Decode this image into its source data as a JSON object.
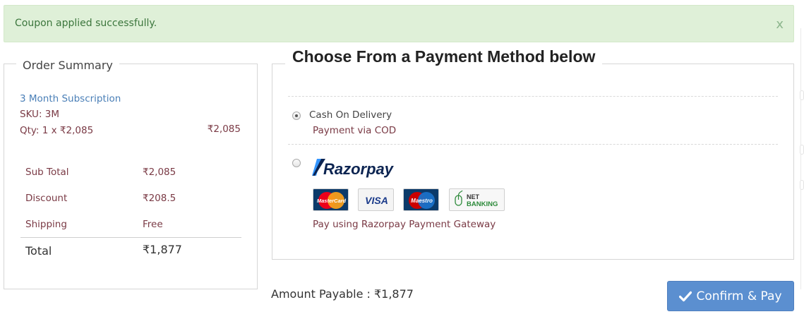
{
  "alert": {
    "message": "Coupon applied successfully.",
    "close_label": "x"
  },
  "order_summary": {
    "title": "Order Summary",
    "item": {
      "name": "3 Month Subscription",
      "sku": "SKU: 3M",
      "qty_line": "Qty: 1 x ₹2,085",
      "line_total": "₹2,085"
    },
    "totals": [
      {
        "label": "Sub Total",
        "value": "₹2,085"
      },
      {
        "label": "Discount",
        "value": "₹208.5"
      },
      {
        "label": "Shipping",
        "value": "Free"
      }
    ],
    "grand_total": {
      "label": "Total",
      "value": "₹1,877"
    }
  },
  "payment": {
    "title": "Choose From a Payment Method below",
    "methods": [
      {
        "name": "Cash On Delivery",
        "description": "Payment via COD",
        "selected": true
      },
      {
        "name": "Razorpay",
        "description": "Pay using Razorpay Payment Gateway",
        "selected": false,
        "cards": [
          {
            "name": "MasterCard",
            "icon": "mastercard-icon"
          },
          {
            "name": "VISA",
            "icon": "visa-icon"
          },
          {
            "name": "Maestro",
            "icon": "maestro-icon"
          },
          {
            "name_line1": "NET",
            "name_line2": "BANKING",
            "icon": "net-banking-icon"
          }
        ]
      }
    ]
  },
  "footer": {
    "amount_payable": "Amount Payable : ₹1,877",
    "confirm_label": "Confirm & Pay"
  },
  "colors": {
    "alert_bg": "#dff0d8",
    "alert_text": "#3c763d",
    "link_blue": "#4a7fb7",
    "value_maroon": "#7a3a45",
    "button_blue": "#5b8fd0"
  }
}
